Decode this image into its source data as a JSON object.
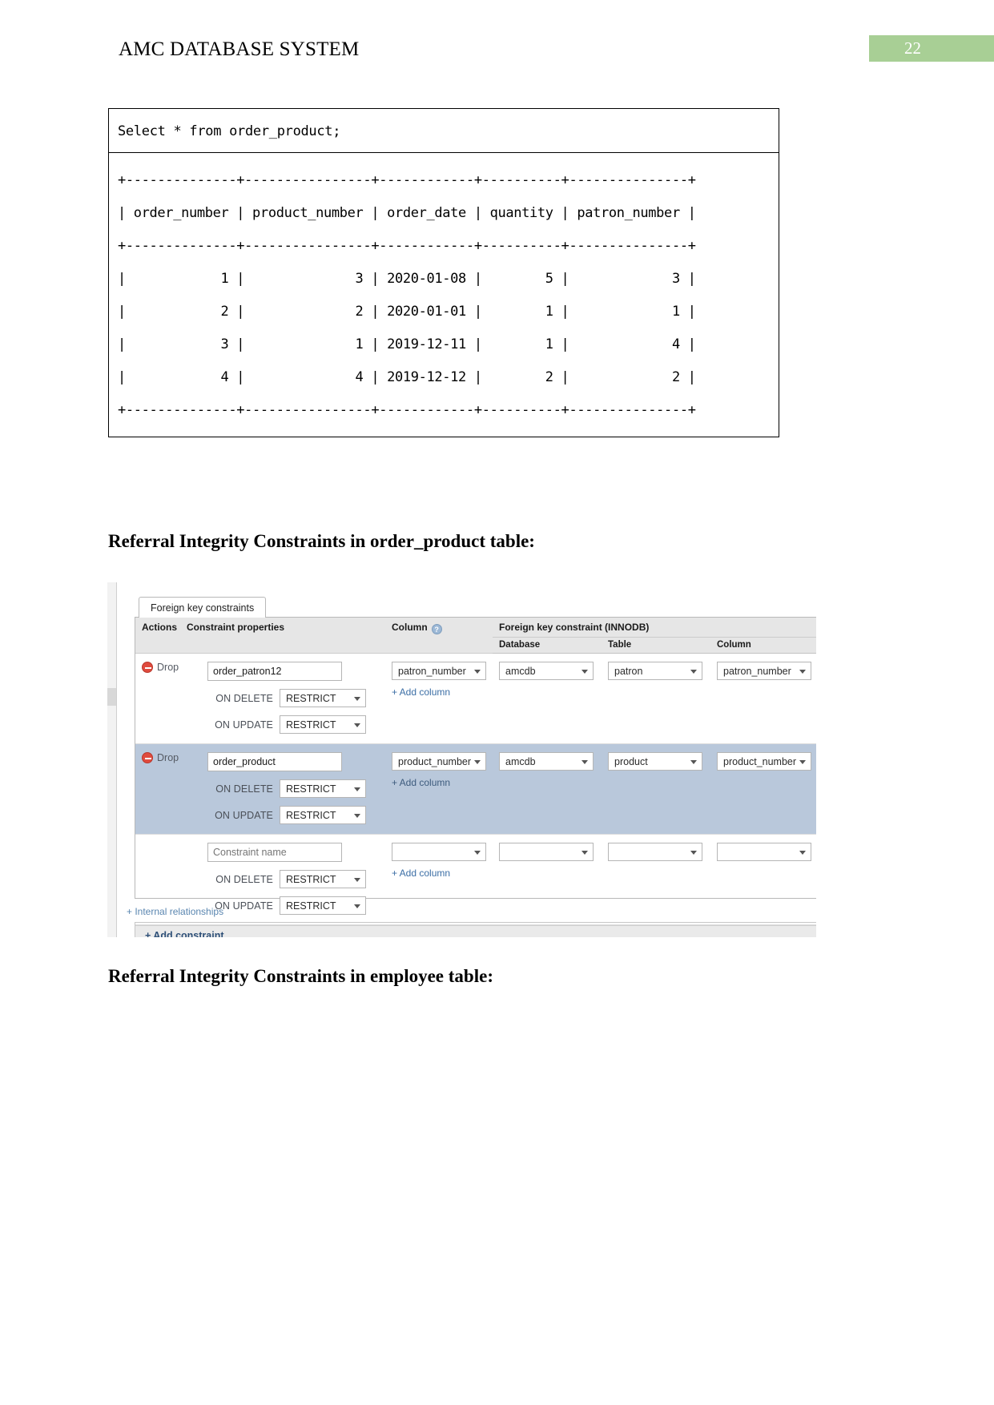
{
  "header": {
    "doc_title": "AMC DATABASE SYSTEM",
    "page_number": "22",
    "badge_color": "#a8cf95"
  },
  "sql_console": {
    "query": "Select * from order_product;",
    "separator": "+--------------+----------------+------------+----------+---------------+",
    "header_row": "| order_number | product_number | order_date | quantity | patron_number |",
    "rows": [
      "|            1 |              3 | 2020-01-08 |        5 |             3 |",
      "|            2 |              2 | 2020-01-01 |        1 |             1 |",
      "|            3 |              1 | 2019-12-11 |        1 |             4 |",
      "|            4 |              4 | 2019-12-12 |        2 |             2 |"
    ],
    "table_name": "order_product",
    "columns": [
      "order_number",
      "product_number",
      "order_date",
      "quantity",
      "patron_number"
    ],
    "data": [
      {
        "order_number": "1",
        "product_number": "3",
        "order_date": "2020-01-08",
        "quantity": "5",
        "patron_number": "3"
      },
      {
        "order_number": "2",
        "product_number": "2",
        "order_date": "2020-01-01",
        "quantity": "1",
        "patron_number": "1"
      },
      {
        "order_number": "3",
        "product_number": "1",
        "order_date": "2019-12-11",
        "quantity": "1",
        "patron_number": "4"
      },
      {
        "order_number": "4",
        "product_number": "4",
        "order_date": "2019-12-12",
        "quantity": "2",
        "patron_number": "2"
      }
    ]
  },
  "headings": {
    "order_product": "Referral Integrity Constraints in order_product table:",
    "employee": "Referral Integrity Constraints in employee table:"
  },
  "fk_panel": {
    "tab_label": "Foreign key constraints",
    "columns": {
      "actions": "Actions",
      "constraint_properties": "Constraint properties",
      "column": "Column",
      "help_icon": "help-icon",
      "fk_group": "Foreign key constraint (INNODB)",
      "database": "Database",
      "table": "Table",
      "fk_column": "Column"
    },
    "labels": {
      "drop": "Drop",
      "on_delete": "ON DELETE",
      "on_update": "ON UPDATE",
      "add_column": "+ Add column",
      "add_constraint": "+ Add constraint",
      "internal_relationships": "+ Internal relationships",
      "constraint_name_placeholder": "Constraint name"
    },
    "constraints": [
      {
        "name": "order_patron12",
        "on_delete": "RESTRICT",
        "on_update": "RESTRICT",
        "column": "patron_number",
        "database": "amcdb",
        "table": "patron",
        "fk_column": "patron_number",
        "highlighted": false,
        "droppable": true
      },
      {
        "name": "order_product",
        "on_delete": "RESTRICT",
        "on_update": "RESTRICT",
        "column": "product_number",
        "database": "amcdb",
        "table": "product",
        "fk_column": "product_number",
        "highlighted": true,
        "droppable": true
      },
      {
        "name": "",
        "on_delete": "RESTRICT",
        "on_update": "RESTRICT",
        "column": "",
        "database": "",
        "table": "",
        "fk_column": "",
        "highlighted": false,
        "droppable": false
      }
    ]
  }
}
